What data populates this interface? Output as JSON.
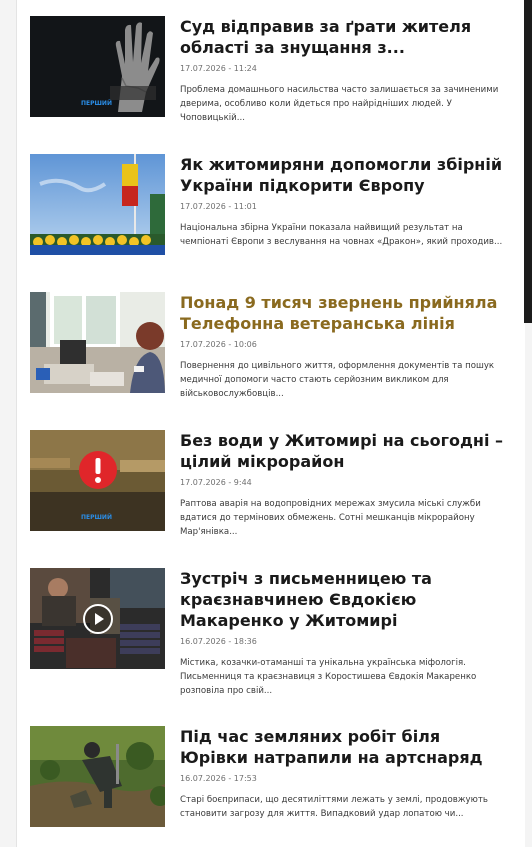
{
  "news": {
    "items": [
      {
        "title": "Суд відправив за ґрати жителя області за знущання з...",
        "date": "17.07.2026 - 11:24",
        "excerpt": "Проблема домашнього насильства часто залишається за зачиненими дверима, особливо коли йдеться про найрідніших людей. У Чоповицькій...",
        "thumb_icon": "hand-photo",
        "thumb_caption": "ПЕРШИЙ"
      },
      {
        "title": "Як житомиряни допомогли збірній України підкорити Європу",
        "date": "17.07.2026 - 11:01",
        "excerpt": "Національна збірна України показала найвищий результат на чемпіонаті Європи з веслування на човнах «Дракон», який проходив...",
        "thumb_icon": "team-flag-photo"
      },
      {
        "title": "Понад 9 тисяч звернень прийняла Телефонна ветеранська лінія",
        "date": "17.07.2026 - 10:06",
        "excerpt": "Повернення до цивільного життя, оформлення документів та пошук медичної допомоги часто стають серйозним викликом для військовослужбовців...",
        "thumb_icon": "office-photo",
        "active": true
      },
      {
        "title": "Без води у Житомирі на сьогодні – цілий мікрорайон",
        "date": "17.07.2026 - 9:44",
        "excerpt": "Раптова аварія на водопровідних мережах змусила міські служби вдатися до термінових обмежень. Сотні мешканців мікрорайону Мар'янівка...",
        "thumb_icon": "alert-icon",
        "thumb_caption": "ПЕРШИЙ"
      },
      {
        "title": "Зустріч з письменницею та краєзнавчинею Євдокією Макаренко у Житомирі",
        "date": "16.07.2026 - 18:36",
        "excerpt": "Містика, козачки-отаманші та унікальна українська міфологія. Письменниця та краєзнавиця з Коростишева Євдокія Макаренко розповіла про свій...",
        "thumb_icon": "play-video-icon"
      },
      {
        "title": "Під час земляних робіт біля Юрівки натрапили на артснаряд",
        "date": "16.07.2026 - 17:53",
        "excerpt": "Старі боєприпаси, що десятиліттями лежать у землі, продовжують становити загрозу для життя. Випадковий удар лопатою чи...",
        "thumb_icon": "sapper-photo"
      }
    ]
  },
  "colors": {
    "title": "#1a1a1a",
    "title_active": "#8a6a1f",
    "date": "#707070",
    "excerpt": "#3a3a3a",
    "alert_red": "#e0262a"
  }
}
